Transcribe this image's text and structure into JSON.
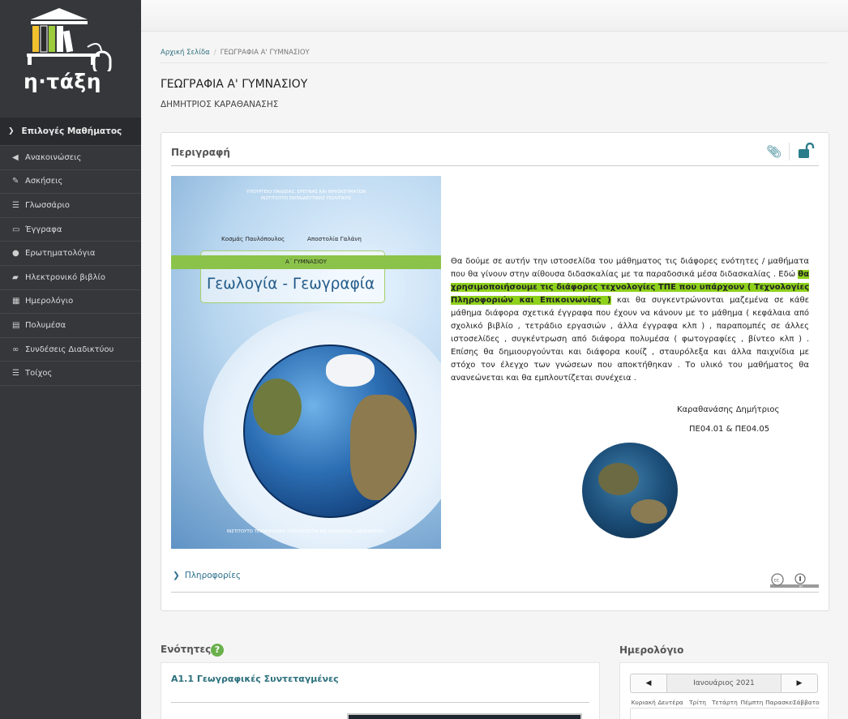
{
  "sidebar": {
    "logo_text": "η·τάξη",
    "menu_header": "Επιλογές Μαθήματος",
    "items": [
      {
        "label": "Ανακοινώσεις",
        "icon": "megaphone-icon"
      },
      {
        "label": "Ασκήσεις",
        "icon": "edit-icon"
      },
      {
        "label": "Γλωσσάριο",
        "icon": "list-icon"
      },
      {
        "label": "Έγγραφα",
        "icon": "folder-open-icon"
      },
      {
        "label": "Ερωτηματολόγια",
        "icon": "question-circle-icon"
      },
      {
        "label": "Ηλεκτρονικό βιβλίο",
        "icon": "book-icon"
      },
      {
        "label": "Ημερολόγιο",
        "icon": "calendar-icon"
      },
      {
        "label": "Πολυμέσα",
        "icon": "film-icon"
      },
      {
        "label": "Συνδέσεις Διαδικτύου",
        "icon": "link-icon"
      },
      {
        "label": "Τοίχος",
        "icon": "wall-list-icon"
      }
    ]
  },
  "breadcrumb": {
    "home": "Αρχική Σελίδα",
    "current": "ΓΕΩΓΡΑΦΙΑ Α' ΓΥΜΝΑΣΙΟΥ"
  },
  "course": {
    "title": "ΓΕΩΓΡΑΦΙΑ Α' ΓΥΜΝΑΣΙΟΥ",
    "teacher": "ΔΗΜΗΤΡΙΟΣ ΚΑΡΑΘΑΝΑΣΗΣ"
  },
  "description": {
    "heading": "Περιγραφή",
    "book": {
      "publisher_line1": "ΥΠΟΥΡΓΕΙΟ ΠΑΙΔΕΙΑΣ, ΕΡΕΥΝΑΣ ΚΑΙ ΘΡΗΣΚΕΥΜΑΤΩΝ",
      "publisher_line2": "ΙΝΣΤΙΤΟΥΤΟ ΕΚΠΑΙΔΕΥΤΙΚΗΣ ΠΟΛΙΤΙΚΗΣ",
      "author1": "Κοσμάς Παυλόπουλος",
      "author2": "Αποστολία Γαλάνη",
      "grade": "Α΄ ΓΥΜΝΑΣΙΟΥ",
      "title": "Γεωλογία - Γεωγραφία",
      "footer": "ΙΝΣΤΙΤΟΥΤΟ ΤΕΧΝΟΛΟΓΙΑΣ ΥΠΟΛΟΓΙΣΤΩΝ ΚΑΙ ΕΚΔΟΣΕΩΝ «ΔΙΟΦΑΝΤΟΣ»"
    },
    "text_part1": "   Θα δούμε σε αυτήν την ιστοσελίδα του μάθηματος τις διάφορες ενότητες  / μαθήματα που θα γίνουν στην αίθουσα διδασκαλίας με τα παραδοσικά μέσα διδασκαλίας . Εδώ ",
    "text_highlight": "θα χρησιμοποιήσουμε τις διάφορες τεχνολογίες ΤΠΕ που υπάρχουν ( Τεχνολογίες Πληροφοριών και Επικοινωνίας )",
    "text_part2": " και θα συγκεντρώνονται μαζεμένα σε κάθε μάθημα διάφορα σχετικά έγγραφα που έχουν να κάνουν με το μάθημα  ( κεφάλαια από σχολικό βιβλίο , τετράδιο εργασιών , άλλα έγγραφα κλπ ) , παραπομπές σε άλλες ιστοσελίδες , συγκέντρωση από διάφορα πολυμέσα (   φωτογραφίες , βίντεο κλπ ) . Επίσης θα δημιουργούνται και διάφορα κουίζ  , σταυρόλεξα και άλλα παιχνίδια με στόχο τον έλεγχο των γνώσεων που αποκτήθηκαν . Το υλικό του μαθήματος θα ανανεώνεται και θα εμπλουτίζεται συνέχεια .",
    "signature": "Καραθανάσης Δημήτριος",
    "signature_code": "ΠΕ04.01 & ΠΕ04.05",
    "info_toggle": "Πληροφορίες",
    "cc_label": "BY"
  },
  "units": {
    "heading": "Ενότητες",
    "help": "?",
    "items": [
      "Α1.1 Γεωγραφικές Συντεταγμένες"
    ]
  },
  "calendar": {
    "heading": "Ημερολόγιο",
    "prev": "◀",
    "next": "▶",
    "month": "Ιανουάριος 2021",
    "days": [
      "Κυριακή",
      "Δευτέρα",
      "Τρίτη",
      "Τετάρτη",
      "Πέμπτη",
      "Παρασκευή",
      "Σάββατο"
    ]
  },
  "colors": {
    "sidebar": "#35373b",
    "accent": "#2b6f7c",
    "highlight": "#8ed11b"
  }
}
